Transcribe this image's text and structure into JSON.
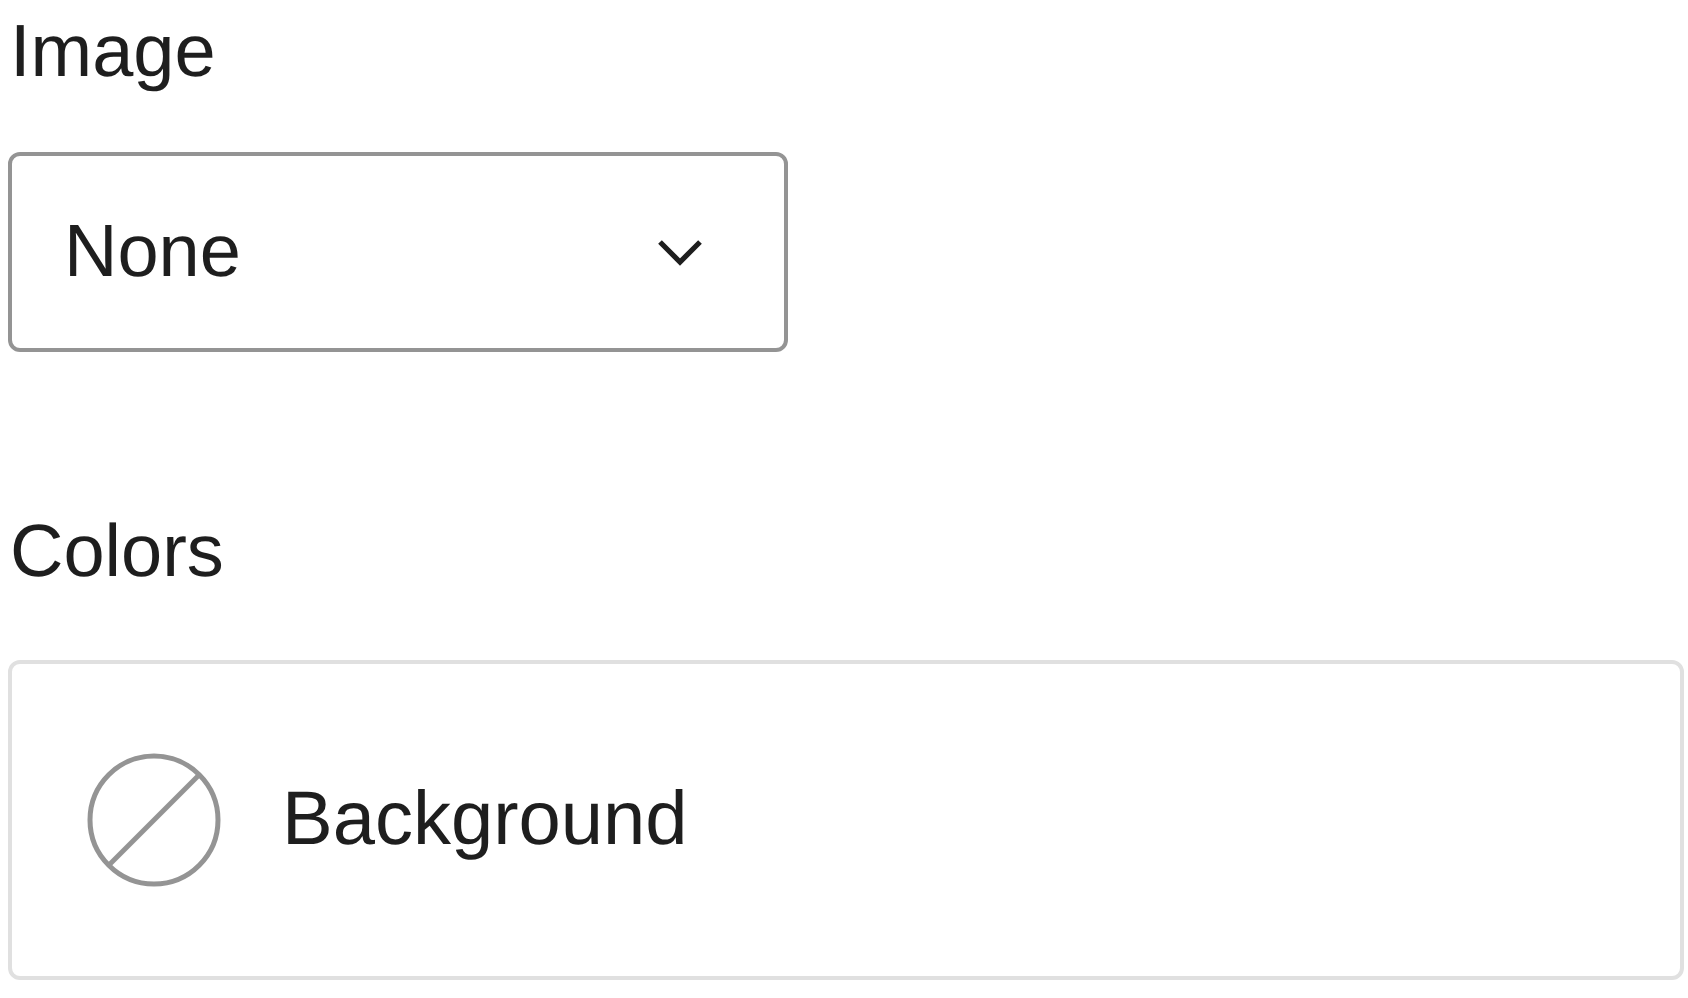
{
  "image": {
    "label": "Image",
    "select": {
      "value": "None"
    }
  },
  "colors": {
    "label": "Colors",
    "items": [
      {
        "label": "Background"
      }
    ]
  }
}
